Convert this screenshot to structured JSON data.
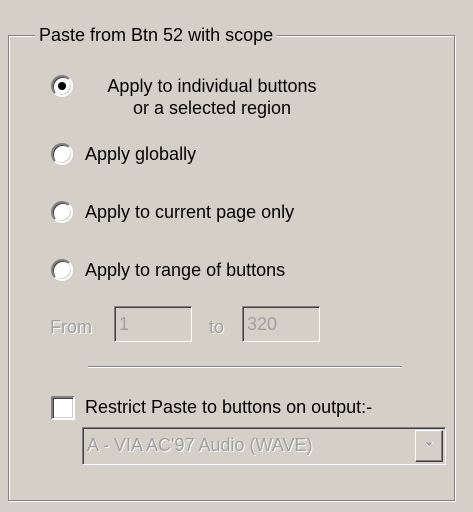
{
  "group": {
    "title": "Paste from Btn 52 with scope"
  },
  "options": [
    {
      "line1": "Apply to individual buttons",
      "line2": "or a selected region",
      "selected": true
    },
    {
      "line1": "Apply globally",
      "selected": false
    },
    {
      "line1": "Apply to current page only",
      "selected": false
    },
    {
      "line1": "Apply to range of buttons",
      "selected": false
    }
  ],
  "range": {
    "from_label": "From",
    "from_value": "1",
    "to_label": "to",
    "to_value": "320",
    "enabled": false
  },
  "restrict": {
    "label": "Restrict Paste to buttons on output:-",
    "checked": false
  },
  "output_select": {
    "selected": "A  - VIA AC'97 Audio (WAVE)",
    "enabled": false,
    "arrow_icon": "chevron-down-icon"
  },
  "colors": {
    "background": "#d4d0c8",
    "disabled_text": "#a0a0a0",
    "shadow": "#808080",
    "highlight": "#ffffff"
  }
}
